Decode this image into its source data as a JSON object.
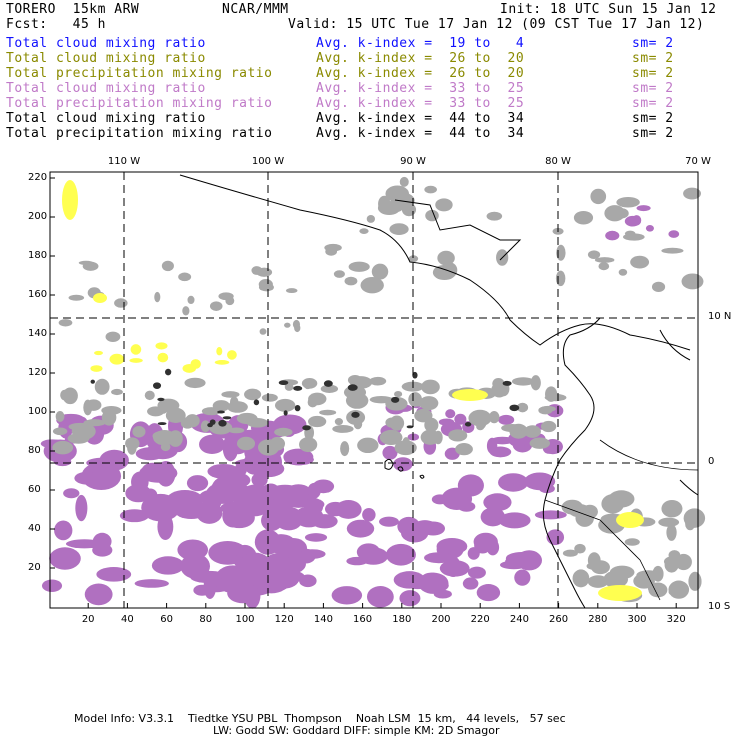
{
  "header": {
    "model": "TORERO  15km ARW",
    "org": "NCAR/MMM",
    "init": "Init: 18 UTC Sun 15 Jan 12",
    "fcst": "Fcst:   45 h",
    "valid": "Valid: 15 UTC Tue 17 Jan 12 (09 CST Tue 17 Jan 12)"
  },
  "legend": [
    {
      "field": "Total cloud mixing ratio",
      "index": "Avg. k-index =  19 to   4",
      "sm": "sm= 2",
      "color": "#1010ff"
    },
    {
      "field": "Total cloud mixing ratio",
      "index": "Avg. k-index =  26 to  20",
      "sm": "sm= 2",
      "color": "#8a8a00"
    },
    {
      "field": "Total precipitation mixing ratio",
      "index": "Avg. k-index =  26 to  20",
      "sm": "sm= 2",
      "color": "#8a8a00"
    },
    {
      "field": "Total cloud mixing ratio",
      "index": "Avg. k-index =  33 to  25",
      "sm": "sm= 2",
      "color": "#c07ac8"
    },
    {
      "field": "Total precipitation mixing ratio",
      "index": "Avg. k-index =  33 to  25",
      "sm": "sm= 2",
      "color": "#c07ac8"
    },
    {
      "field": "Total cloud mixing ratio",
      "index": "Avg. k-index =  44 to  34",
      "sm": "sm= 2",
      "color": "#000000"
    },
    {
      "field": "Total precipitation mixing ratio",
      "index": "Avg. k-index =  44 to  34",
      "sm": "sm= 2",
      "color": "#000000"
    }
  ],
  "map": {
    "lon_labels": [
      "110 W",
      "100 W",
      "90 W",
      "80 W",
      "70 W"
    ],
    "lat_labels": [
      "10 N",
      "0",
      "10 S"
    ],
    "y_ticks": [
      "220",
      "200",
      "180",
      "160",
      "140",
      "120",
      "100",
      "80",
      "60",
      "40",
      "20"
    ],
    "x_ticks": [
      "20",
      "40",
      "60",
      "80",
      "100",
      "120",
      "140",
      "160",
      "180",
      "200",
      "220",
      "240",
      "260",
      "280",
      "300",
      "320"
    ],
    "colors": {
      "low_cloud": "#ffff50",
      "mid_cloud": "#b070c0",
      "high_cloud": "#a8a8a8",
      "dense": "#303030"
    }
  },
  "footer": {
    "line1": "Model Info: V3.3.1    Tiedtke YSU PBL  Thompson    Noah LSM  15 km,   44 levels,   57 sec",
    "line2": "LW: Godd SW: Goddard DIFF: simple KM: 2D Smagor"
  }
}
